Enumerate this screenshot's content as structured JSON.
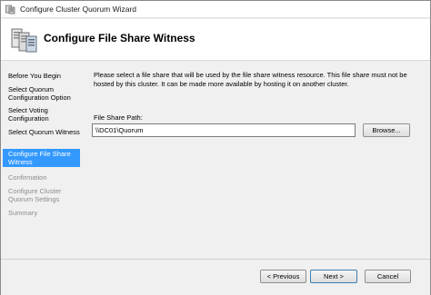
{
  "window": {
    "title": "Configure Cluster Quorum Wizard"
  },
  "header": {
    "title": "Configure File Share Witness",
    "icon": "cluster-quorum-icon"
  },
  "nav": {
    "items": [
      {
        "label": "Before You Begin",
        "state": "normal"
      },
      {
        "label": "Select Quorum Configuration Option",
        "state": "normal"
      },
      {
        "label": "Select Voting Configuration",
        "state": "normal"
      },
      {
        "label": "Select Quorum Witness",
        "state": "normal"
      },
      {
        "label": "Configure File Share Witness",
        "state": "active"
      },
      {
        "label": "Confirmation",
        "state": "disabled"
      },
      {
        "label": "Configure Cluster Quorum Settings",
        "state": "disabled"
      },
      {
        "label": "Summary",
        "state": "disabled"
      }
    ]
  },
  "main": {
    "description": "Please select a file share that will be used by the file share witness resource.  This file share must not be hosted by this cluster.  It can be made more available by hosting it on another cluster.",
    "path_label": "File Share Path:",
    "path_value": "\\\\DC01\\Quorum",
    "browse_label": "Browse..."
  },
  "footer": {
    "previous_label": "< Previous",
    "next_label": "Next >",
    "cancel_label": "Cancel"
  },
  "colors": {
    "active_nav_bg": "#3399ff",
    "disabled_text": "#8c8c8c"
  }
}
